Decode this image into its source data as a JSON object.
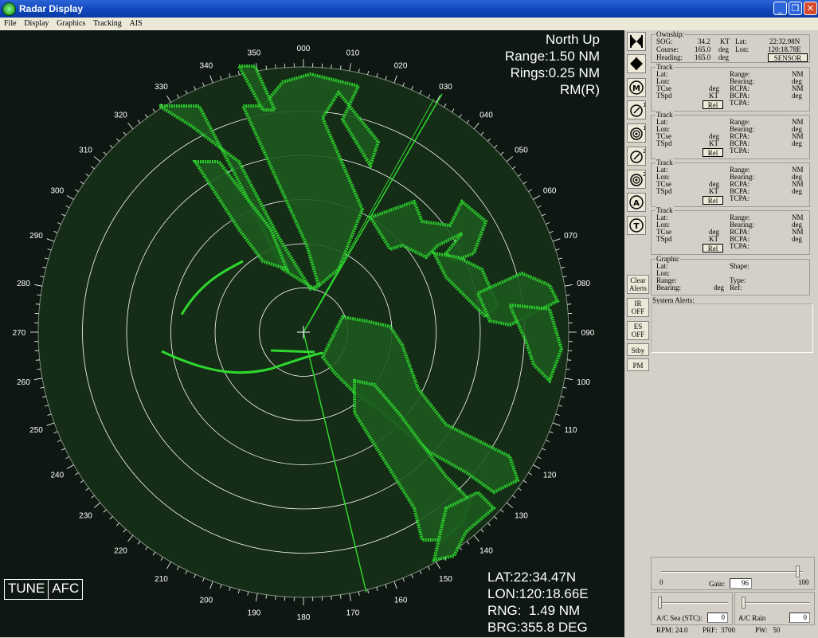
{
  "window": {
    "title": "Radar Display"
  },
  "menu": [
    "File",
    "Display",
    "Graphics",
    "Tracking",
    "AIS"
  ],
  "radar": {
    "mode": "North Up",
    "range": "Range:1.50 NM",
    "rings": "Rings:0.25 NM",
    "motion": "RM(R)",
    "cursor_lat": "LAT:22:34.47N",
    "cursor_lon": "LON:120:18.66E",
    "cursor_rng": "RNG:  1.49 NM",
    "cursor_brg": "BRG:355.8 DEG",
    "tune": "TUNE",
    "afc": "AFC",
    "bearing_labels": [
      "000",
      "010",
      "020",
      "030",
      "040",
      "050",
      "060",
      "070",
      "080",
      "090",
      "100",
      "110",
      "120",
      "130",
      "140",
      "150",
      "160",
      "170",
      "180",
      "190",
      "200",
      "210",
      "220",
      "230",
      "240",
      "250",
      "260",
      "270",
      "280",
      "290",
      "300",
      "310",
      "320",
      "330",
      "340",
      "350"
    ],
    "colors": {
      "echo": "#2fd82f",
      "background": "#0e1711",
      "ring": "#ffffff"
    }
  },
  "side_buttons": {
    "clear_alerts": "Clear Alerts",
    "ir": "IR OFF",
    "es": "ES OFF",
    "stby": "Stby",
    "pm": "PM"
  },
  "ownship": {
    "legend": "Ownship:",
    "sog_label": "SOG:",
    "sog_value": "34.2",
    "sog_unit": "KT",
    "course_label": "Course:",
    "course_value": "165.0",
    "course_unit": "deg",
    "heading_label": "Heading:",
    "heading_value": "165.0",
    "heading_unit": "deg",
    "lat_label": "Lat:",
    "lat_value": "22:32.98N",
    "lon_label": "Lon:",
    "lon_value": "120:18.78E",
    "sensor_button": "SENSOR"
  },
  "track_labels": {
    "legend": "Track",
    "lat": "Lat:",
    "lon": "Lon:",
    "tcse": "TCse",
    "tspd": "TSpd",
    "deg": "deg",
    "kt": "KT",
    "rel": "Rel",
    "range": "Range:",
    "bearing": "Bearing:",
    "rcpa": "RCPA:",
    "bcpa": "BCPA:",
    "tcpa": "TCPA:",
    "nm": "NM"
  },
  "graphic": {
    "legend": "Graphic",
    "lat": "Lat:",
    "lon": "Lon:",
    "range": "Range:",
    "bearing": "Bearing:",
    "deg": "deg",
    "shape": "Shape:",
    "type": "Type:",
    "ref": "Ref:"
  },
  "system_alerts": {
    "label": "System Alerts:"
  },
  "gain": {
    "min": "0",
    "max": "100",
    "label": "Gain:",
    "value": "96",
    "level": 0.96
  },
  "ac_sea": {
    "label": "A/C Sea (STC):",
    "value": "0"
  },
  "ac_rain": {
    "label": "A/C Rain",
    "value": "0"
  },
  "status": {
    "rpm": "RPM: 24.0",
    "prf": "PRF:  3700",
    "pw": "PW:   50"
  }
}
